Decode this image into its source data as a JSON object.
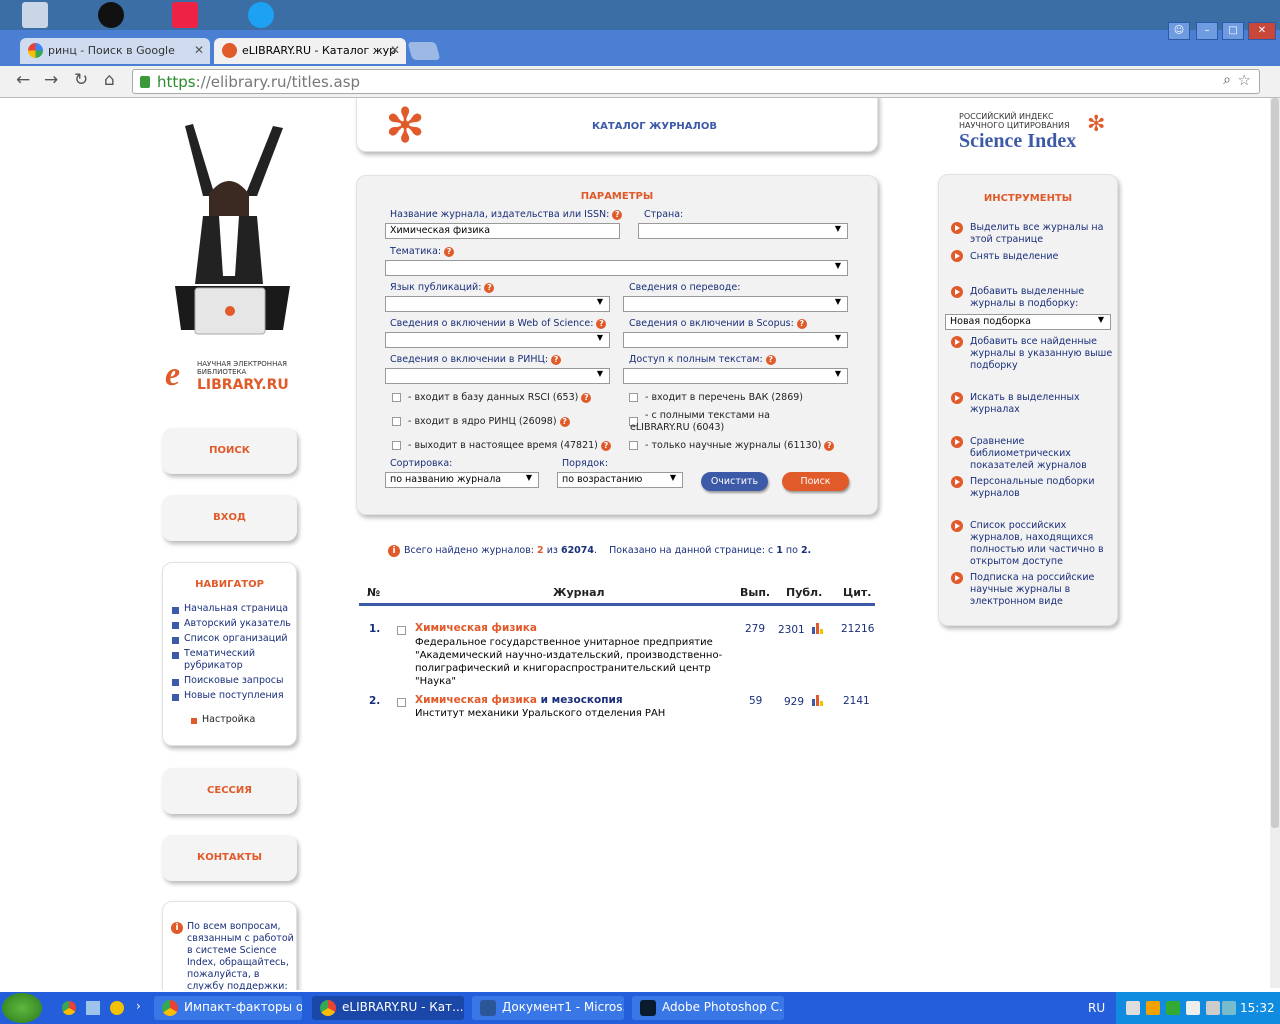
{
  "browser": {
    "tabs": [
      {
        "label": "ринц - Поиск в Google"
      },
      {
        "label": "eLIBRARY.RU - Каталог жур"
      }
    ],
    "url_scheme": "https",
    "url_rest": "://elibrary.ru/titles.asp"
  },
  "logo": {
    "tagline_1": "НАУЧНАЯ ЭЛЕКТРОННАЯ",
    "tagline_2": "БИБЛИОТЕКА",
    "brand": "LIBRARY.RU",
    "brand_e": "e"
  },
  "header": {
    "title": "КАТАЛОГ ЖУРНАЛОВ"
  },
  "science_index": {
    "line1": "РОССИЙСКИЙ ИНДЕКС",
    "line2": "НАУЧНОГО ЦИТИРОВАНИЯ",
    "brand": "Science Index"
  },
  "side_buttons": {
    "search": "ПОИСК",
    "login": "ВХОД",
    "session": "СЕССИЯ",
    "contacts": "КОНТАКТЫ"
  },
  "navigator": {
    "title": "НАВИГАТОР",
    "items": [
      "Начальная страница",
      "Авторский указатель",
      "Список организаций",
      "Тематический",
      "рубрикатор",
      "Поисковые запросы",
      "Новые поступления"
    ],
    "settings": "Настройка"
  },
  "help_box": {
    "lines": [
      "По всем вопросам,",
      "связанным с работой",
      "в системе Science",
      "Index, обращайтесь,",
      "пожалуйста, в",
      "службу поддержки:"
    ]
  },
  "params": {
    "title": "ПАРАМЕТРЫ",
    "journal_label": "Название журнала, издательства или ISSN:",
    "journal_value": "Химическая физика",
    "country_label": "Страна:",
    "topic_label": "Тематика:",
    "lang_label": "Язык публикаций:",
    "translation_label": "Сведения о переводе:",
    "wos_label": "Сведения о включении в Web of Science:",
    "scopus_label": "Сведения о включении в Scopus:",
    "rinc_label": "Сведения о включении в РИНЦ:",
    "fulltext_label": "Доступ к полным текстам:",
    "cb_rsci": "- входит в базу данных RSCI (653)",
    "cb_vak": "- входит в перечень ВАК (2869)",
    "cb_core": "- входит в ядро РИНЦ (26098)",
    "cb_fulltext_1": "- с полными текстами на",
    "cb_fulltext_2": "eLIBRARY.RU (6043)",
    "cb_current": "- выходит в настоящее время (47821)",
    "cb_scientific": "- только научные журналы (61130)",
    "sort_label": "Сортировка:",
    "sort_value": "по названию журнала",
    "order_label": "Порядок:",
    "order_value": "по возрастанию",
    "clear_button": "Очистить",
    "search_button": "Поиск"
  },
  "summary": {
    "prefix": "Всего найдено журналов:",
    "found": "2",
    "of": "из",
    "total": "62074",
    "shown": "Показано на данной странице: с",
    "from": "1",
    "to_word": "по",
    "to": "2."
  },
  "table": {
    "headers": {
      "num": "№",
      "journal": "Журнал",
      "issues": "Вып.",
      "pubs": "Публ.",
      "cites": "Цит."
    },
    "rows": [
      {
        "num": "1.",
        "title": "Химическая физика",
        "title_rest": "",
        "publisher": [
          "Федеральное государственное унитарное предприятие",
          "\"Академический научно-издательский, производственно-",
          "полиграфический и книгораспространительский центр",
          "\"Наука\""
        ],
        "issues": "279",
        "pubs": "2301",
        "cites": "21216"
      },
      {
        "num": "2.",
        "title": "Химическая физика",
        "title_rest": " и мезоскопия",
        "publisher": [
          "Институт механики Уральского отделения РАН"
        ],
        "issues": "59",
        "pubs": "929",
        "cites": "2141"
      }
    ]
  },
  "tools": {
    "title": "ИНСТРУМЕНТЫ",
    "select_all": [
      "Выделить все журналы на",
      "этой странице"
    ],
    "deselect": [
      "Снять выделение"
    ],
    "add_selected": [
      "Добавить выделенные",
      "журналы в подборку:"
    ],
    "collection_value": "Новая подборка",
    "add_found": [
      "Добавить все найденные",
      "журналы в указанную выше",
      "подборку"
    ],
    "search_selected": [
      "Искать в выделенных",
      "журналах"
    ],
    "compare": [
      "Сравнение",
      "библиометрических",
      "показателей журналов"
    ],
    "personal": [
      "Персональные подборки",
      "журналов"
    ],
    "list_open": [
      "Список российских",
      "журналов, находящихся",
      "полностью или частично в",
      "открытом доступе"
    ],
    "subscribe": [
      "Подписка на российские",
      "научные журналы в",
      "электронном виде"
    ]
  },
  "taskbar": {
    "items": [
      "Импакт-факторы о...",
      "eLIBRARY.RU - Кат...",
      "Документ1 - Micros...",
      "Adobe Photoshop C..."
    ],
    "lang": "RU",
    "time": "15:32"
  },
  "colors": {
    "accent": "#e05a2a",
    "navy": "#1a2f7a",
    "taskbar": "#245edb"
  }
}
